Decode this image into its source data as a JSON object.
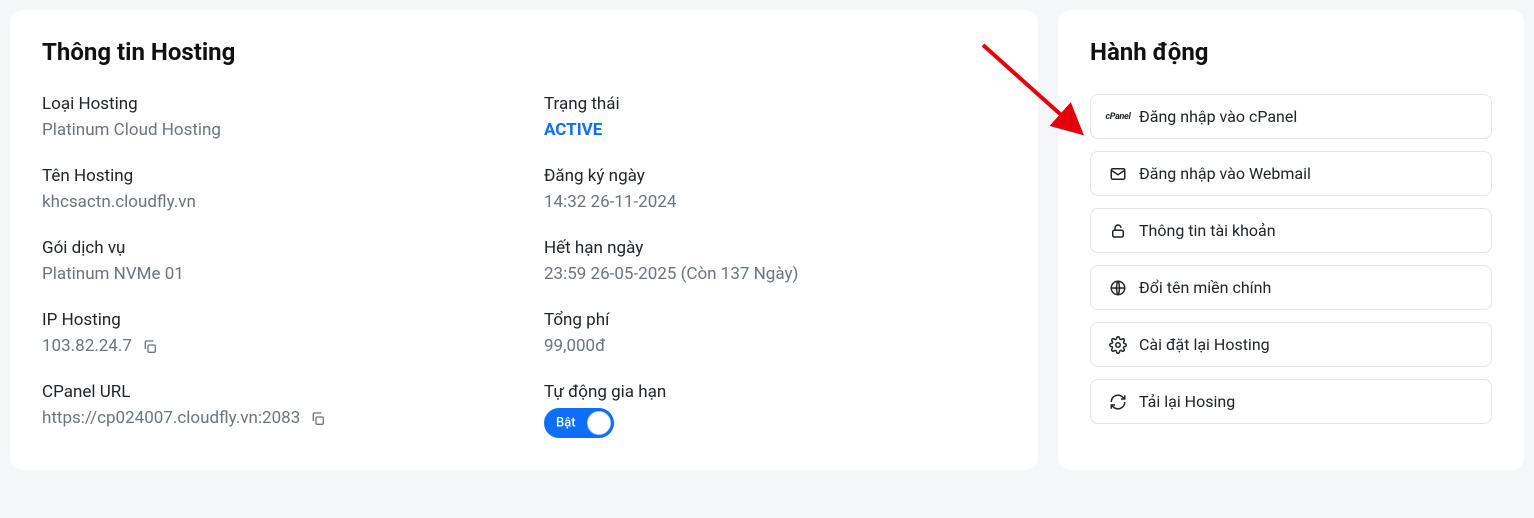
{
  "hosting_info": {
    "title": "Thông tin Hosting",
    "type": {
      "label": "Loại Hosting",
      "value": "Platinum Cloud Hosting"
    },
    "status": {
      "label": "Trạng thái",
      "value": "ACTIVE"
    },
    "name": {
      "label": "Tên Hosting",
      "value": "khcsactn.cloudfly.vn"
    },
    "registered": {
      "label": "Đăng ký ngày",
      "value": "14:32 26-11-2024"
    },
    "package": {
      "label": "Gói dịch vụ",
      "value": "Platinum NVMe 01"
    },
    "expiry": {
      "label": "Hết hạn ngày",
      "value": "23:59 26-05-2025 (Còn 137 Ngày)"
    },
    "ip": {
      "label": "IP Hosting",
      "value": "103.82.24.7"
    },
    "total": {
      "label": "Tổng phí",
      "value": "99,000đ"
    },
    "cpanel_url": {
      "label": "CPanel URL",
      "value": "https://cp024007.cloudfly.vn:2083"
    },
    "auto_renew": {
      "label": "Tự động gia hạn",
      "toggle_state": "Bật"
    }
  },
  "actions": {
    "title": "Hành động",
    "items": [
      {
        "label": "Đăng nhập vào cPanel",
        "icon": "cpanel"
      },
      {
        "label": "Đăng nhập vào Webmail",
        "icon": "mail"
      },
      {
        "label": "Thông tin tài khoản",
        "icon": "lock"
      },
      {
        "label": "Đổi tên miền chính",
        "icon": "globe"
      },
      {
        "label": "Cài đặt lại Hosting",
        "icon": "gear"
      },
      {
        "label": "Tải lại Hosing",
        "icon": "reload"
      }
    ]
  }
}
